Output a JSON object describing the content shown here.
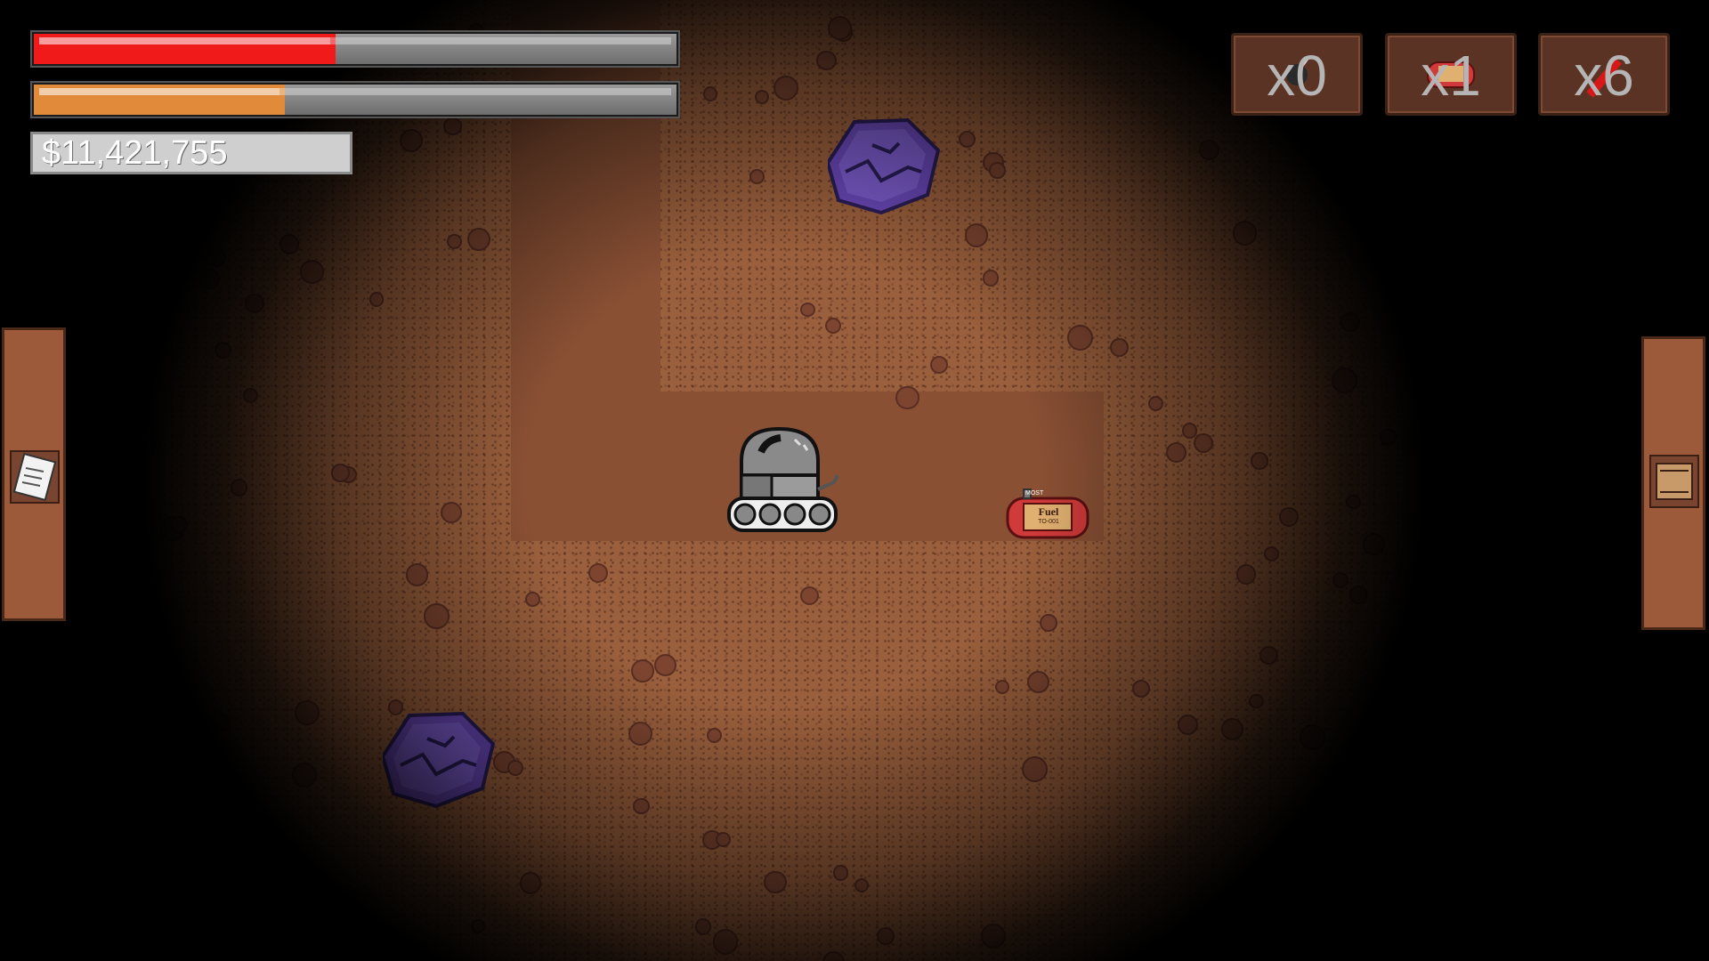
{
  "hud": {
    "health": {
      "value": 0.47,
      "color": "#f01a1a"
    },
    "fuel": {
      "value": 0.39,
      "color": "#e08a3a"
    },
    "money": "$11,421,755"
  },
  "inventory": [
    {
      "name": "drill-charge",
      "count": "x0",
      "icon": "bomb-icon"
    },
    {
      "name": "fuel-tank",
      "count": "x1",
      "icon": "fuel-can-icon"
    },
    {
      "name": "dynamite",
      "count": "x6",
      "icon": "dynamite-icon"
    }
  ],
  "side_panels": {
    "left_icon": "map-scroll-icon",
    "right_icon": "cargo-box-icon"
  },
  "world": {
    "fuel_pickup_label": "Fuel",
    "fuel_pickup_sublabel": "TO-001",
    "fuel_pickup_top_label": "MOST",
    "gems": [
      "amethyst",
      "amethyst"
    ],
    "player": "mining-drill-vehicle"
  }
}
